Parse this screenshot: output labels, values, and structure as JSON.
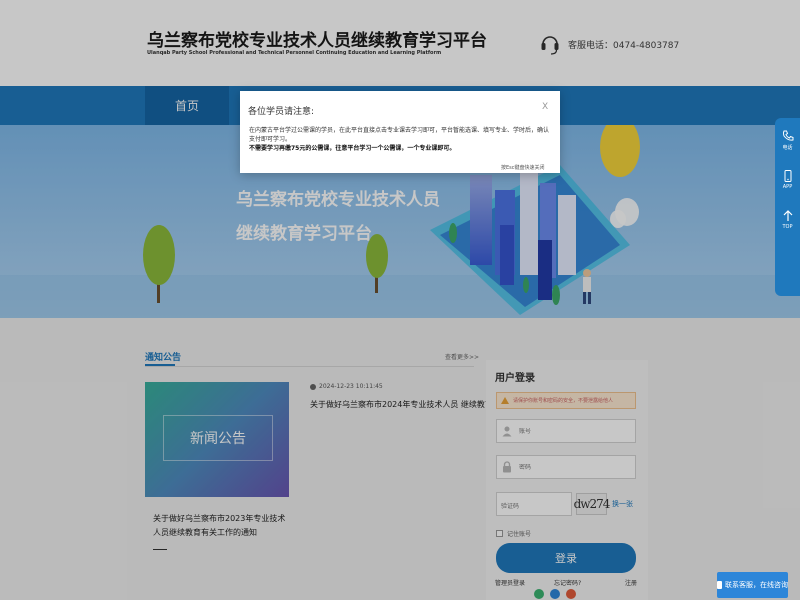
{
  "header": {
    "logo_cn": "乌兰察布党校专业技术人员继续教育学习平台",
    "logo_en": "Ulanqab Party School Professional and Technical Personnel Continuing Education and Learning Platform",
    "phone": "客服电话：0474-4803787"
  },
  "nav": {
    "home": "首页"
  },
  "banner": {
    "line1": "乌兰察布党校专业技术人员",
    "line2": "继续教育学习平台"
  },
  "float_bar": [
    {
      "label": "电话",
      "icon": "phone-icon"
    },
    {
      "label": "APP",
      "icon": "mobile-icon"
    },
    {
      "label": "TOP",
      "icon": "arrow-up-icon"
    }
  ],
  "notice": {
    "title": "通知公告",
    "more": "查看更多>>",
    "featured_image_text": "新闻公告",
    "featured_caption": "关于做好乌兰察布市2023年专业技术人员继续教育有关工作的通知",
    "items": [
      {
        "date": "2024-12-23 10:11:45",
        "title": "关于做好乌兰察布市2024年专业技术人员 继续教育..."
      }
    ]
  },
  "login": {
    "title": "用户登录",
    "warning": "请保护你账号和密码的安全，不要泄露给他人",
    "username_placeholder": "账号",
    "password_placeholder": "密码",
    "captcha_placeholder": "验证码",
    "captcha_text": "dw274",
    "refresh": "换一张",
    "remember": "记住账号",
    "submit": "登录",
    "admin_link": "管理员登录",
    "forgot_link": "忘记密码?",
    "register_link": "注册"
  },
  "modal": {
    "title": "各位学员请注意:",
    "close": "X",
    "body_line1": "在内蒙古平台学过公需课的学员，在此平台直接点击专业课去学习即可，平台暂能选课、填写专业、学时后，确认支付即可学习。",
    "body_line2": "不需要学习再缴75元的公需课，往意平台学习一个公需课，一个专业课即可。",
    "hint": "按Esc键盘快速关闭"
  },
  "customer_service": {
    "label": "联系客服，在线咨询"
  },
  "colors": {
    "primary": "#1f79bd",
    "nav": "#1f79bd",
    "warning_bg": "#fde9d2"
  }
}
